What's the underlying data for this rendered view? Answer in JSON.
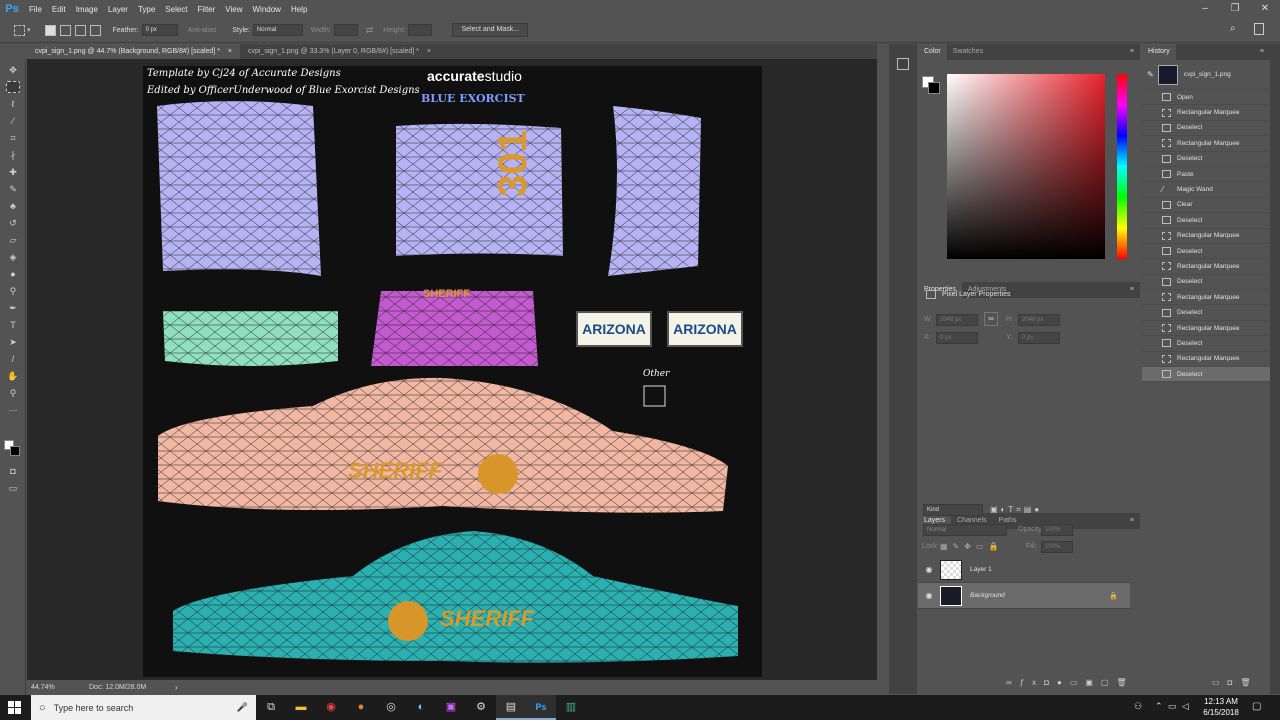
{
  "app": {
    "logo": "Ps"
  },
  "menu": [
    "File",
    "Edit",
    "Image",
    "Layer",
    "Type",
    "Select",
    "Filter",
    "View",
    "Window",
    "Help"
  ],
  "options": {
    "feather_label": "Feather:",
    "feather_value": "0 px",
    "antialias": "Anti-alias",
    "style_label": "Style:",
    "style_value": "Normal",
    "width_label": "Width:",
    "height_label": "Height:",
    "select_mask": "Select and Mask..."
  },
  "tabs": [
    {
      "label": "cvpi_sign_1.png @ 44.7% (Background, RGB/8#) [scaled] *",
      "close": "×"
    },
    {
      "label": "cvpi_sign_1.png @ 33.3% (Layer 0, RGB/8#) [scaled] *",
      "close": "×"
    }
  ],
  "canvas": {
    "credit1": "Template by Cj24 of Accurate Designs",
    "credit2": "Edited by OfficerUnderwood of Blue Exorcist Designs",
    "logo_accurate_bold": "accurate",
    "logo_accurate_light": "studio",
    "logo_blue": "BLUE EXORCIST",
    "roof_number": "301",
    "bumper_text": "SHERIFF",
    "plate1": "ARIZONA",
    "plate2": "ARIZONA",
    "other_label": "Other",
    "door_text": "SHERIFF"
  },
  "status": {
    "zoom": "44.74%",
    "doc": "Doc: 12.0M/28.0M"
  },
  "color_panel": {
    "tabs": [
      "Color",
      "Swatches"
    ]
  },
  "properties": {
    "tabs": [
      "Properties",
      "Adjustments"
    ],
    "title": "Pixel Layer Properties",
    "w_label": "W:",
    "w_value": "2048 px",
    "h_label": "H:",
    "h_value": "2048 px",
    "x_label": "X:",
    "x_value": "0 px",
    "y_label": "Y:",
    "y_value": "0 px"
  },
  "layers": {
    "tabs": [
      "Layers",
      "Channels",
      "Paths"
    ],
    "kind": "Kind",
    "blend": "Normal",
    "opacity_label": "Opacity:",
    "opacity_value": "100%",
    "lock_label": "Lock:",
    "fill_label": "Fill:",
    "fill_value": "100%",
    "items": [
      {
        "name": "Layer 1",
        "selected": false
      },
      {
        "name": "Background",
        "selected": true
      }
    ]
  },
  "history": {
    "title": "History",
    "snapshot": "cvpi_sign_1.png",
    "items": [
      "Open",
      "Rectangular Marquee",
      "Deselect",
      "Rectangular Marquee",
      "Deselect",
      "Paste",
      "Magic Wand",
      "Clear",
      "Deselect",
      "Rectangular Marquee",
      "Deselect",
      "Rectangular Marquee",
      "Deselect",
      "Rectangular Marquee",
      "Deselect",
      "Rectangular Marquee",
      "Deselect",
      "Rectangular Marquee",
      "Deselect"
    ]
  },
  "taskbar": {
    "search_placeholder": "Type here to search",
    "time": "12:13 AM",
    "date": "6/15/2018"
  }
}
